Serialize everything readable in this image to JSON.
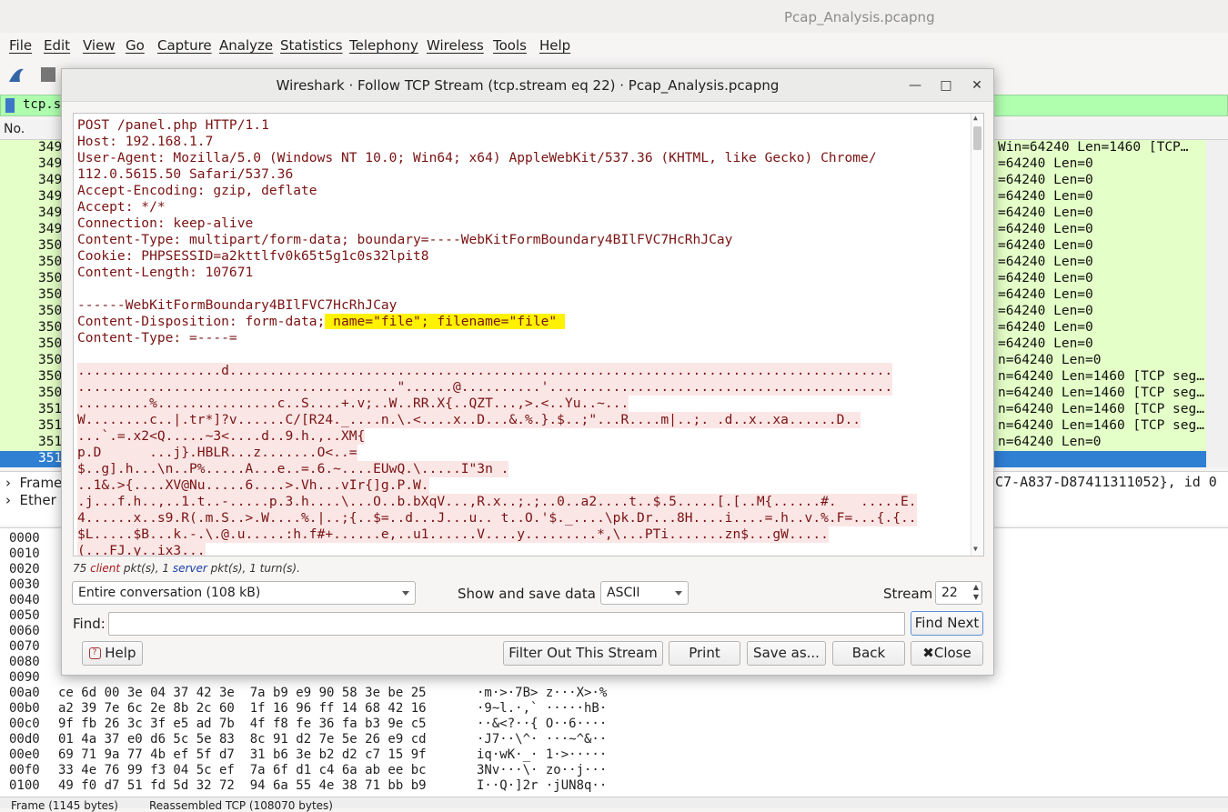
{
  "main_window": {
    "title": "Pcap_Analysis.pcapng",
    "menu": [
      "File",
      "Edit",
      "View",
      "Go",
      "Capture",
      "Analyze",
      "Statistics",
      "Telephony",
      "Wireless",
      "Tools",
      "Help"
    ],
    "filter_text": "tcp.str",
    "list_header_no": "No.",
    "packets": [
      {
        "no": "349",
        "info": "Win=64240 Len=1460 [TCP…"
      },
      {
        "no": "349",
        "info": "=64240 Len=0"
      },
      {
        "no": "349",
        "info": "=64240 Len=0"
      },
      {
        "no": "349",
        "info": "=64240 Len=0"
      },
      {
        "no": "349",
        "info": "=64240 Len=0"
      },
      {
        "no": "349",
        "info": "=64240 Len=0"
      },
      {
        "no": "350",
        "info": "=64240 Len=0"
      },
      {
        "no": "350",
        "info": "=64240 Len=0"
      },
      {
        "no": "350",
        "info": "=64240 Len=0"
      },
      {
        "no": "350",
        "info": "=64240 Len=0"
      },
      {
        "no": "350",
        "info": "=64240 Len=0"
      },
      {
        "no": "350",
        "info": "=64240 Len=0"
      },
      {
        "no": "350",
        "info": "=64240 Len=0"
      },
      {
        "no": "350",
        "info": "n=64240 Len=0"
      },
      {
        "no": "350",
        "info": "n=64240 Len=1460 [TCP seg…"
      },
      {
        "no": "350",
        "info": "n=64240 Len=1460 [TCP seg…"
      },
      {
        "no": "351",
        "info": "n=64240 Len=1460 [TCP seg…"
      },
      {
        "no": "351",
        "info": "n=64240 Len=1460 [TCP seg…"
      },
      {
        "no": "351",
        "info": "n=64240 Len=0"
      },
      {
        "no": "351",
        "info": ""
      }
    ],
    "details": {
      "frame_label": "Frame",
      "ether_label": "Ether",
      "frame_suffix": "C7-A837-D87411311052}, id 0"
    },
    "hex_rows": [
      {
        "off": "0000",
        "hex": "",
        "asc": ""
      },
      {
        "off": "0010",
        "hex": "",
        "asc": ""
      },
      {
        "off": "0020",
        "hex": "",
        "asc": ""
      },
      {
        "off": "0030",
        "hex": "",
        "asc": ""
      },
      {
        "off": "0040",
        "hex": "",
        "asc": ""
      },
      {
        "off": "0050",
        "hex": "",
        "asc": ""
      },
      {
        "off": "0060",
        "hex": "",
        "asc": ""
      },
      {
        "off": "0070",
        "hex": "",
        "asc": ""
      },
      {
        "off": "0080",
        "hex": "",
        "asc": ""
      },
      {
        "off": "0090",
        "hex": "",
        "asc": ""
      },
      {
        "off": "00a0",
        "hex": "ce 6d 00 3e 04 37 42 3e  7a b9 e9 90 58 3e be 25",
        "asc": "·m·>·7B> z···X>·%"
      },
      {
        "off": "00b0",
        "hex": "a2 39 7e 6c 2e 8b 2c 60  1f 16 96 ff 14 68 42 16",
        "asc": "·9~l.·,` ·····hB·"
      },
      {
        "off": "00c0",
        "hex": "9f fb 26 3c 3f e5 ad 7b  4f f8 fe 36 fa b3 9e c5",
        "asc": "··&<?··{ O··6····"
      },
      {
        "off": "00d0",
        "hex": "01 4a 37 e0 d6 5c 5e 83  8c 91 d2 7e 5e 26 e9 cd",
        "asc": "·J7··\\^· ···~^&··"
      },
      {
        "off": "00e0",
        "hex": "69 71 9a 77 4b ef 5f d7  31 b6 3e b2 d2 c7 15 9f",
        "asc": "iq·wK·_· 1·>·····"
      },
      {
        "off": "00f0",
        "hex": "33 4e 76 99 f3 04 5c ef  7a 6f d1 c4 6a ab ee bc",
        "asc": "3Nv···\\· zo··j···"
      },
      {
        "off": "0100",
        "hex": "49 f0 d7 51 fd 5d 32 72  94 6a 55 4e 38 71 bb b9",
        "asc": "I··Q·]2r ·jUN8q··"
      }
    ],
    "bottom_tabs": [
      "Frame (1145 bytes)",
      "Reassembled TCP (108070 bytes)"
    ]
  },
  "dialog": {
    "title": "Wireshark · Follow TCP Stream (tcp.stream eq 22) · Pcap_Analysis.pcapng",
    "stream_lines": [
      "POST /panel.php HTTP/1.1",
      "Host: 192.168.1.7",
      "User-Agent: Mozilla/5.0 (Windows NT 10.0; Win64; x64) AppleWebKit/537.36 (KHTML, like Gecko) Chrome/",
      "112.0.5615.50 Safari/537.36",
      "Accept-Encoding: gzip, deflate",
      "Accept: */*",
      "Connection: keep-alive",
      "Content-Type: multipart/form-data; boundary=----WebKitFormBoundary4BIlFVC7HcRhJCay",
      "Cookie: PHPSESSID=a2kttlfv0k65t5g1c0s32lpit8",
      "Content-Length: 107671",
      "",
      "------WebKitFormBoundary4BIlFVC7HcRhJCay"
    ],
    "disposition_prefix": "Content-Disposition: form-data;",
    "disposition_highlight": " name=\"file\"; filename=\"file\" ",
    "content_type_line": "Content-Type: =----=",
    "binary_lines": [
      "..................d...................................................................................",
      "........................................\"......@..........'...........................................",
      ".........%...............c..S....+.v;..W..RR.X{..QZT...,>.<..Yu..~...",
      "W........c..|.tr*]?v......C/[R24._....n.\\.<....x..D...&.%.}.$..;\"...R....m|..;. .d..x..xa......D..",
      "...`.=.x2<Q.....~3<....d..9.h.,..XM{",
      "p.D      ...j}.HBLR...z.......O<..=",
      "$..g].h...\\n..P%.....A...e..=.6.~....EUwQ.\\.....I\"3n .",
      "..1&.>{....XV@Nu.....6....>.Vh...vIr{]g.P.W.",
      ".j...f.h..,..1.t..-.....p.3.h....\\...O..b.bXqV...,R.x..;.;..0..a2....t..$.5.....[.[..M{......#.   .....E.",
      "4......x..s9.R(.m.S..>.W....%.|..;{..$=..d...J...u.. t..O.'$._....\\pk.Dr...8H....i....=.h..v.%.F=...{.{..",
      "$L.....$B...k.-.\\.@.u.....:h.f#+......e,..u1......V....y.........*,\\...PTi.......zn$...gW.....",
      "(...FJ.y..ix3..."
    ],
    "stats": {
      "client_count": "75",
      "client_word": "client",
      "middle": " pkt(s), 1 ",
      "server_word": "server",
      "tail": " pkt(s), 1 turn(s)."
    },
    "conversation_select": "Entire conversation (108 kB)",
    "show_save_label": "Show and save data as",
    "format_select": "ASCII",
    "stream_label": "Stream",
    "stream_value": "22",
    "find_label": "Find:",
    "find_value": "",
    "find_next": "Find Next",
    "help": "Help",
    "filter_out": "Filter Out This Stream",
    "print": "Print",
    "save_as": "Save as...",
    "back": "Back",
    "close": "Close"
  },
  "colors": {
    "client_text": "#7a1313",
    "highlight": "#fff200",
    "selected_row": "#2f7fd3",
    "packet_bg": "#e4ffc7",
    "filter_bg": "#afffaf"
  }
}
